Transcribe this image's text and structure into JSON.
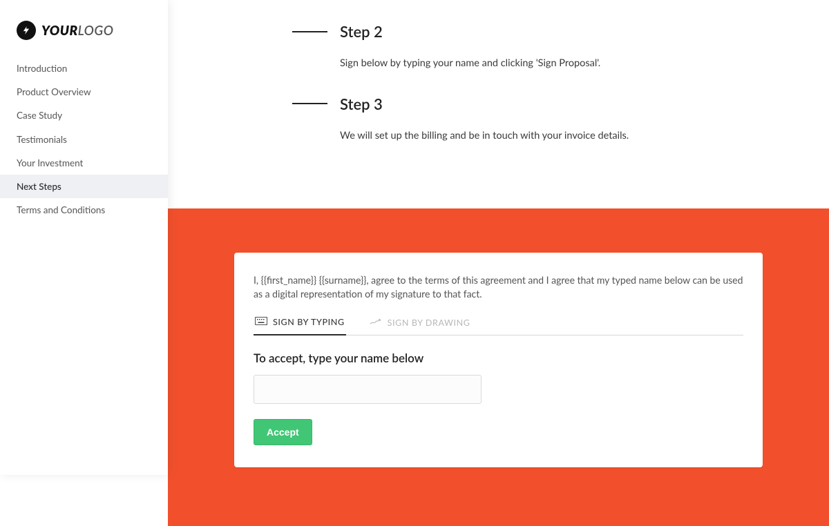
{
  "colors": {
    "accent": "#f2502c",
    "accept": "#41c676"
  },
  "logo": {
    "bold": "YOUR",
    "light": "LOGO"
  },
  "sidebar": {
    "items": [
      {
        "label": "Introduction",
        "active": false
      },
      {
        "label": "Product Overview",
        "active": false
      },
      {
        "label": "Case Study",
        "active": false
      },
      {
        "label": "Testimonials",
        "active": false
      },
      {
        "label": "Your Investment",
        "active": false
      },
      {
        "label": "Next Steps",
        "active": true
      },
      {
        "label": "Terms and Conditions",
        "active": false
      }
    ]
  },
  "steps": [
    {
      "title": "Step 2",
      "body": "Sign below by typing your name and clicking 'Sign Proposal'."
    },
    {
      "title": "Step 3",
      "body": "We will set up the billing and be in touch with your invoice details."
    }
  ],
  "signature": {
    "agree_text": "I, {{first_name}} {{surname}}, agree to the terms of this agreement and I agree that my typed name below can be used as a digital representation of my signature to that fact.",
    "tab_type": "SIGN BY TYPING",
    "tab_draw": "SIGN BY DRAWING",
    "prompt": "To accept, type your name below",
    "input_value": "",
    "accept_label": "Accept"
  }
}
